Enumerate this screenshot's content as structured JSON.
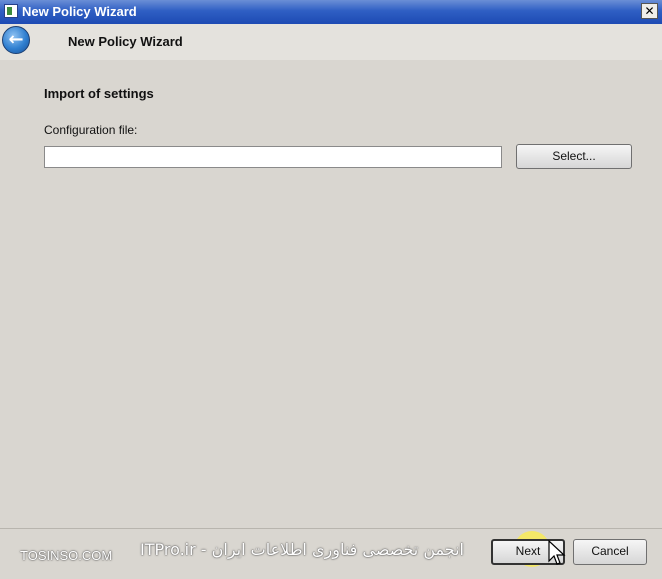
{
  "window": {
    "title": "New Policy Wizard",
    "close_glyph": "✕"
  },
  "header": {
    "back_glyph": "←",
    "title": "New Policy Wizard"
  },
  "main": {
    "section_title": "Import of settings",
    "config_label": "Configuration file:",
    "config_value": "",
    "select_button": "Select..."
  },
  "footer": {
    "next_button": "Next",
    "cancel_button": "Cancel"
  },
  "overlay": {
    "watermark_left": "TOSINSO.COM",
    "watermark_center": "ITPro.ir - انجمن تخصصی فناوری اطلاعات ایران"
  },
  "colors": {
    "titlebar": "#2f5fc4",
    "background": "#d9d6d0",
    "highlight": "#fff03c"
  },
  "icons": [
    "app-icon",
    "back-arrow-icon",
    "close-icon",
    "mouse-pointer-icon"
  ]
}
